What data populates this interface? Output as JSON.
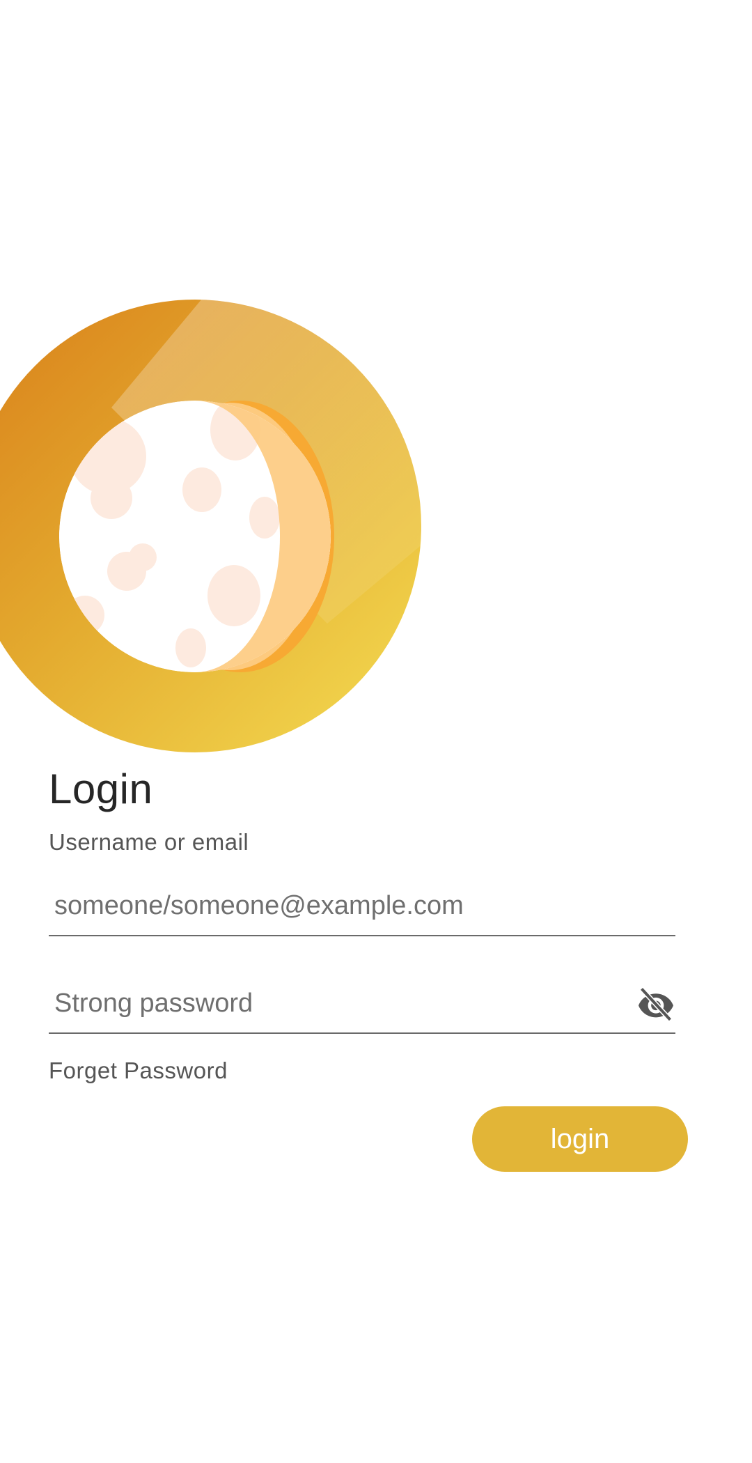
{
  "login": {
    "title": "Login",
    "username_label": "Username or email",
    "username_placeholder": "someone/someone@example.com",
    "password_placeholder": "Strong password",
    "forgot_label": "Forget Password",
    "submit_label": "login"
  },
  "icons": {
    "logo": "moon-logo",
    "password_toggle": "eye-off-icon"
  },
  "colors": {
    "accent": "#e2b537",
    "ring_dark": "#dc8a1e",
    "ring_light": "#f1d34c",
    "crescent": "#f7a933",
    "crater": "#fdeadf",
    "text": "#262626",
    "muted": "#555555"
  }
}
